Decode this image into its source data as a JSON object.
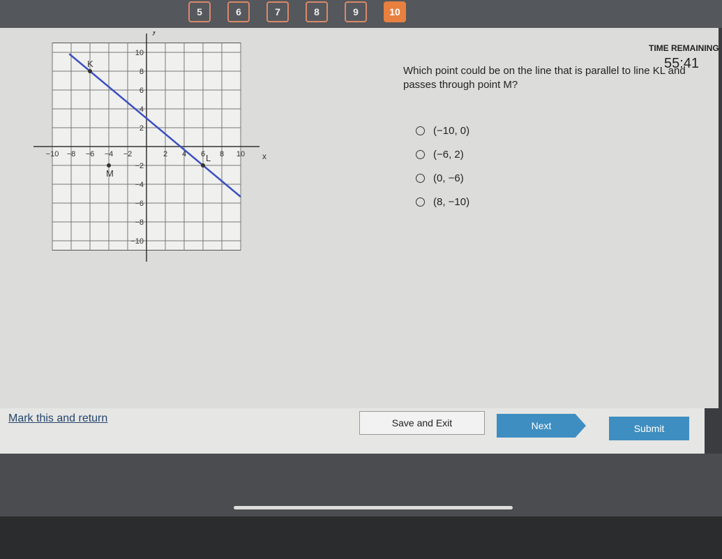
{
  "nav": {
    "questions": [
      "5",
      "6",
      "7",
      "8",
      "9",
      "10"
    ],
    "active": "10",
    "accent": "#e8803f"
  },
  "timer": {
    "label": "TIME REMAINING",
    "value": "55:41"
  },
  "question": {
    "text": "Which point could be on the line that is parallel to line KL and passes through point M?",
    "options": [
      "(−10, 0)",
      "(−6, 2)",
      "(0, −6)",
      "(8, −10)"
    ]
  },
  "graph": {
    "x_label": "x",
    "y_label": "y",
    "x_ticks": [
      "−10",
      "−8",
      "−6",
      "−4",
      "−2",
      "2",
      "4",
      "6",
      "8",
      "10"
    ],
    "y_ticks": [
      "10",
      "8",
      "6",
      "4",
      "2",
      "−2",
      "−4",
      "−6",
      "−8",
      "−10"
    ],
    "points": [
      {
        "label": "K",
        "x": -6,
        "y": 8
      },
      {
        "label": "L",
        "x": 6,
        "y": -2
      },
      {
        "label": "M",
        "x": -4,
        "y": -2
      }
    ],
    "line_color": "#3a4fc0"
  },
  "footer": {
    "mark": "Mark this and return",
    "save": "Save and Exit",
    "next": "Next",
    "submit": "Submit"
  }
}
